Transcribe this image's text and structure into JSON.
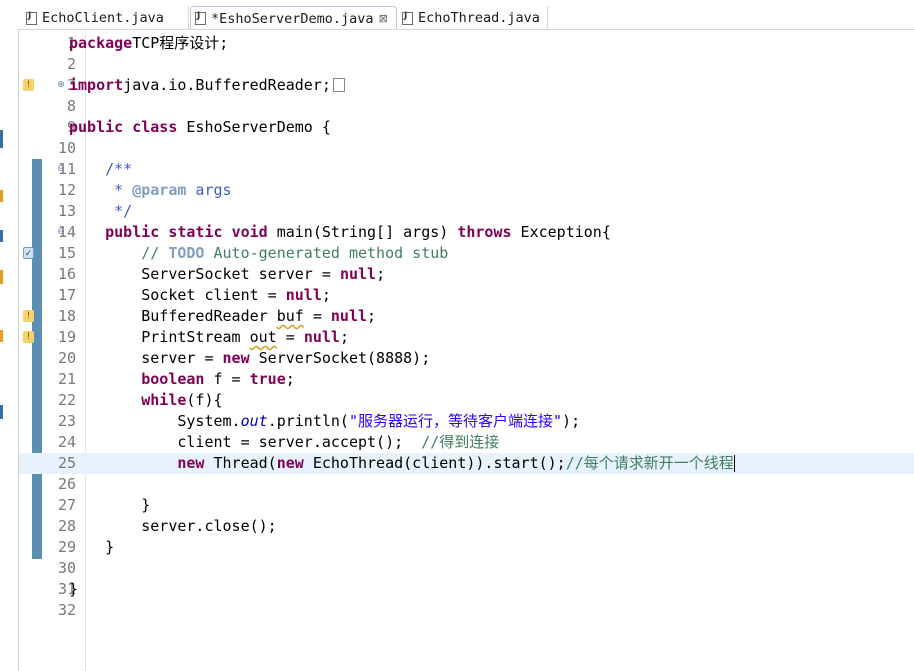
{
  "tabs": [
    {
      "label": "EchoClient.java",
      "active": false,
      "dirty": false
    },
    {
      "label": "*EshoServerDemo.java",
      "active": true,
      "dirty": true
    },
    {
      "label": "EchoThread.java",
      "active": false,
      "dirty": false
    }
  ],
  "close_glyph": "⊠",
  "colors": {
    "keyword": "#7f0055",
    "string": "#2a00ff",
    "comment": "#3f7f5f",
    "javadoc": "#3f5fbf",
    "javadoc_tag": "#7f9fbf",
    "static_field": "#0000c0",
    "line_number": "#787878",
    "current_line": "#e8f2fe",
    "change_bar": "#5b8fb1"
  },
  "editor": {
    "current_line": 25,
    "lines": [
      {
        "n": "1",
        "tokens": [
          [
            "kw",
            "package"
          ],
          [
            "",
            "TCP程序设计;"
          ]
        ]
      },
      {
        "n": "2",
        "tokens": []
      },
      {
        "n": "3",
        "fold": "expand",
        "annotation": "warning-icon",
        "tokens": [
          [
            "kw",
            "import"
          ],
          [
            "",
            "java.io.BufferedReader;"
          ]
        ],
        "folded": true
      },
      {
        "n": "8",
        "tokens": []
      },
      {
        "n": "9",
        "tokens": [
          [
            "kw",
            "public"
          ],
          [
            "",
            " "
          ],
          [
            "kw",
            "class"
          ],
          [
            "",
            " EshoServerDemo {"
          ]
        ]
      },
      {
        "n": "10",
        "tokens": []
      },
      {
        "n": "11",
        "fold": "collapse",
        "changed": true,
        "tokens": [
          [
            "",
            "    "
          ],
          [
            "jd",
            "/**"
          ]
        ]
      },
      {
        "n": "12",
        "changed": true,
        "tokens": [
          [
            "",
            "     "
          ],
          [
            "jd",
            "* "
          ],
          [
            "tag",
            "@param"
          ],
          [
            "jd",
            " args"
          ]
        ]
      },
      {
        "n": "13",
        "changed": true,
        "tokens": [
          [
            "",
            "     "
          ],
          [
            "jd",
            "*/"
          ]
        ]
      },
      {
        "n": "14",
        "fold": "collapse",
        "changed": true,
        "tokens": [
          [
            "",
            "    "
          ],
          [
            "kw",
            "public"
          ],
          [
            "",
            " "
          ],
          [
            "kw",
            "static"
          ],
          [
            "",
            " "
          ],
          [
            "kw",
            "void"
          ],
          [
            "",
            " main(String[] args) "
          ],
          [
            "kw",
            "throws"
          ],
          [
            "",
            " Exception{"
          ]
        ]
      },
      {
        "n": "15",
        "changed": true,
        "annotation": "task-icon",
        "tokens": [
          [
            "",
            "        "
          ],
          [
            "cmt",
            "// "
          ],
          [
            "todo",
            "TODO"
          ],
          [
            "cmt",
            " Auto-generated method stub"
          ]
        ]
      },
      {
        "n": "16",
        "changed": true,
        "tokens": [
          [
            "",
            "        ServerSocket server = "
          ],
          [
            "kw",
            "null"
          ],
          [
            "",
            ";"
          ]
        ]
      },
      {
        "n": "17",
        "changed": true,
        "tokens": [
          [
            "",
            "        Socket client = "
          ],
          [
            "kw",
            "null"
          ],
          [
            "",
            ";"
          ]
        ]
      },
      {
        "n": "18",
        "changed": true,
        "annotation": "warning-icon",
        "tokens": [
          [
            "",
            "        BufferedReader "
          ],
          [
            "warn",
            "buf"
          ],
          [
            "",
            " = "
          ],
          [
            "kw",
            "null"
          ],
          [
            "",
            ";"
          ]
        ]
      },
      {
        "n": "19",
        "changed": true,
        "annotation": "warning-icon",
        "tokens": [
          [
            "",
            "        PrintStream "
          ],
          [
            "warn",
            "out"
          ],
          [
            "",
            " = "
          ],
          [
            "kw",
            "null"
          ],
          [
            "",
            ";"
          ]
        ]
      },
      {
        "n": "20",
        "changed": true,
        "tokens": [
          [
            "",
            "        server = "
          ],
          [
            "kw",
            "new"
          ],
          [
            "",
            " ServerSocket(8888);"
          ]
        ]
      },
      {
        "n": "21",
        "changed": true,
        "tokens": [
          [
            "",
            "        "
          ],
          [
            "kw",
            "boolean"
          ],
          [
            "",
            " f = "
          ],
          [
            "kw",
            "true"
          ],
          [
            "",
            ";"
          ]
        ]
      },
      {
        "n": "22",
        "changed": true,
        "tokens": [
          [
            "",
            "        "
          ],
          [
            "kw",
            "while"
          ],
          [
            "",
            "(f){"
          ]
        ]
      },
      {
        "n": "23",
        "changed": true,
        "tokens": [
          [
            "",
            "            System."
          ],
          [
            "fld",
            "out"
          ],
          [
            "",
            ".println("
          ],
          [
            "str",
            "\"服务器运行，等待客户端连接\""
          ],
          [
            "",
            ");"
          ]
        ]
      },
      {
        "n": "24",
        "changed": true,
        "tokens": [
          [
            "",
            "            client = server.accept();  "
          ],
          [
            "cmt",
            "//得到连接"
          ]
        ]
      },
      {
        "n": "25",
        "changed": true,
        "tokens": [
          [
            "",
            "            "
          ],
          [
            "kw",
            "new"
          ],
          [
            "",
            " Thread("
          ],
          [
            "kw",
            "new"
          ],
          [
            "",
            " EchoThread(client)).start();"
          ],
          [
            "cmt",
            "//每个请求新开一个线程"
          ]
        ],
        "caret": true
      },
      {
        "n": "26",
        "changed": true,
        "tokens": []
      },
      {
        "n": "27",
        "changed": true,
        "tokens": [
          [
            "",
            "        }"
          ]
        ]
      },
      {
        "n": "28",
        "changed": true,
        "tokens": [
          [
            "",
            "        server.close();"
          ]
        ]
      },
      {
        "n": "29",
        "changed": true,
        "tokens": [
          [
            "",
            "    }"
          ]
        ]
      },
      {
        "n": "30",
        "tokens": []
      },
      {
        "n": "31",
        "tokens": [
          [
            "",
            "}"
          ]
        ]
      },
      {
        "n": "32",
        "tokens": []
      }
    ]
  }
}
